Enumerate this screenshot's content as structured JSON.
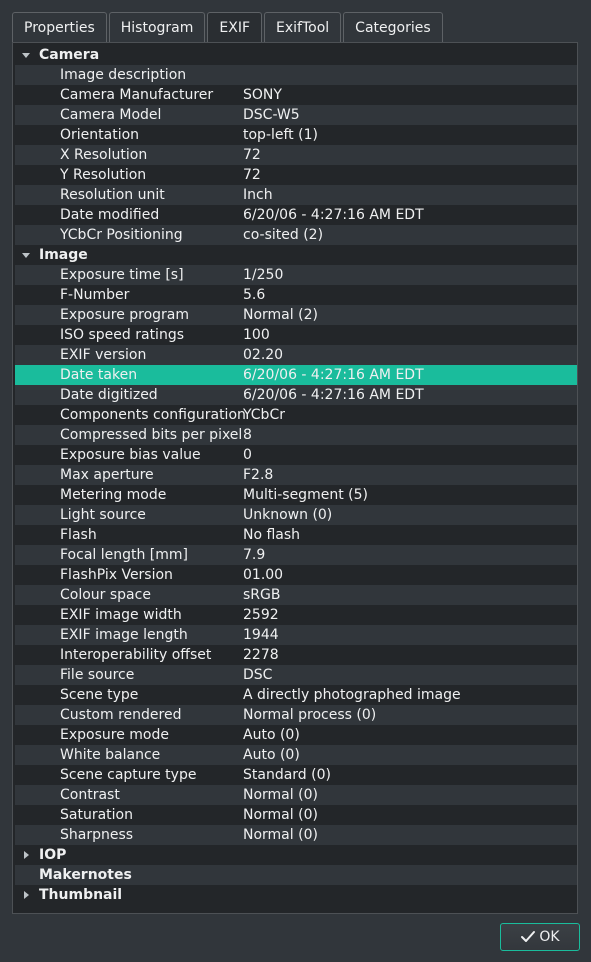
{
  "tabs": [
    {
      "label": "Properties",
      "active": false
    },
    {
      "label": "Histogram",
      "active": false
    },
    {
      "label": "EXIF",
      "active": true
    },
    {
      "label": "ExifTool",
      "active": false
    },
    {
      "label": "Categories",
      "active": false
    }
  ],
  "tree": {
    "groups": [
      {
        "label": "Camera",
        "expanded": true,
        "rows": [
          {
            "key": "Image description",
            "value": ""
          },
          {
            "key": "Camera Manufacturer",
            "value": "SONY"
          },
          {
            "key": "Camera Model",
            "value": "DSC-W5"
          },
          {
            "key": "Orientation",
            "value": "top-left (1)"
          },
          {
            "key": "X Resolution",
            "value": "72"
          },
          {
            "key": "Y Resolution",
            "value": "72"
          },
          {
            "key": "Resolution unit",
            "value": "Inch"
          },
          {
            "key": "Date modified",
            "value": "6/20/06 - 4:27:16 AM EDT"
          },
          {
            "key": "YCbCr Positioning",
            "value": "co-sited (2)"
          }
        ]
      },
      {
        "label": "Image",
        "expanded": true,
        "rows": [
          {
            "key": "Exposure time [s]",
            "value": "1/250"
          },
          {
            "key": "F-Number",
            "value": "5.6"
          },
          {
            "key": "Exposure program",
            "value": "Normal (2)"
          },
          {
            "key": "ISO speed ratings",
            "value": "100"
          },
          {
            "key": "EXIF version",
            "value": "02.20"
          },
          {
            "key": "Date taken",
            "value": "6/20/06 - 4:27:16 AM EDT",
            "selected": true
          },
          {
            "key": "Date digitized",
            "value": "6/20/06 - 4:27:16 AM EDT"
          },
          {
            "key": "Components configuration",
            "value": "YCbCr"
          },
          {
            "key": "Compressed bits per pixel",
            "value": "8"
          },
          {
            "key": "Exposure bias value",
            "value": "0"
          },
          {
            "key": "Max aperture",
            "value": "F2.8"
          },
          {
            "key": "Metering mode",
            "value": "Multi-segment (5)"
          },
          {
            "key": "Light source",
            "value": "Unknown (0)"
          },
          {
            "key": "Flash",
            "value": "No flash"
          },
          {
            "key": "Focal length [mm]",
            "value": "7.9"
          },
          {
            "key": "FlashPix Version",
            "value": "01.00"
          },
          {
            "key": "Colour space",
            "value": "sRGB"
          },
          {
            "key": "EXIF image width",
            "value": "2592"
          },
          {
            "key": "EXIF image length",
            "value": "1944"
          },
          {
            "key": "Interoperability offset",
            "value": "2278"
          },
          {
            "key": "File source",
            "value": "DSC"
          },
          {
            "key": "Scene type",
            "value": "A directly photographed image"
          },
          {
            "key": "Custom rendered",
            "value": "Normal process (0)"
          },
          {
            "key": "Exposure mode",
            "value": "Auto (0)"
          },
          {
            "key": "White balance",
            "value": "Auto (0)"
          },
          {
            "key": "Scene capture type",
            "value": "Standard (0)"
          },
          {
            "key": "Contrast",
            "value": "Normal (0)"
          },
          {
            "key": "Saturation",
            "value": "Normal (0)"
          },
          {
            "key": "Sharpness",
            "value": "Normal (0)"
          }
        ]
      },
      {
        "label": "IOP",
        "expanded": false,
        "has_children": true,
        "rows": []
      },
      {
        "label": "Makernotes",
        "expanded": false,
        "has_children": false,
        "rows": []
      },
      {
        "label": "Thumbnail",
        "expanded": false,
        "has_children": true,
        "rows": []
      }
    ]
  },
  "footer": {
    "ok_label": "OK",
    "ok_icon": "ok-check-icon"
  },
  "colors": {
    "window_bg": "#31363b",
    "view_bg": "#232629",
    "alt_row_bg": "#31363b",
    "selection": "#1abc9c",
    "text": "#eff0f1",
    "focus_border": "#1abc9c"
  }
}
